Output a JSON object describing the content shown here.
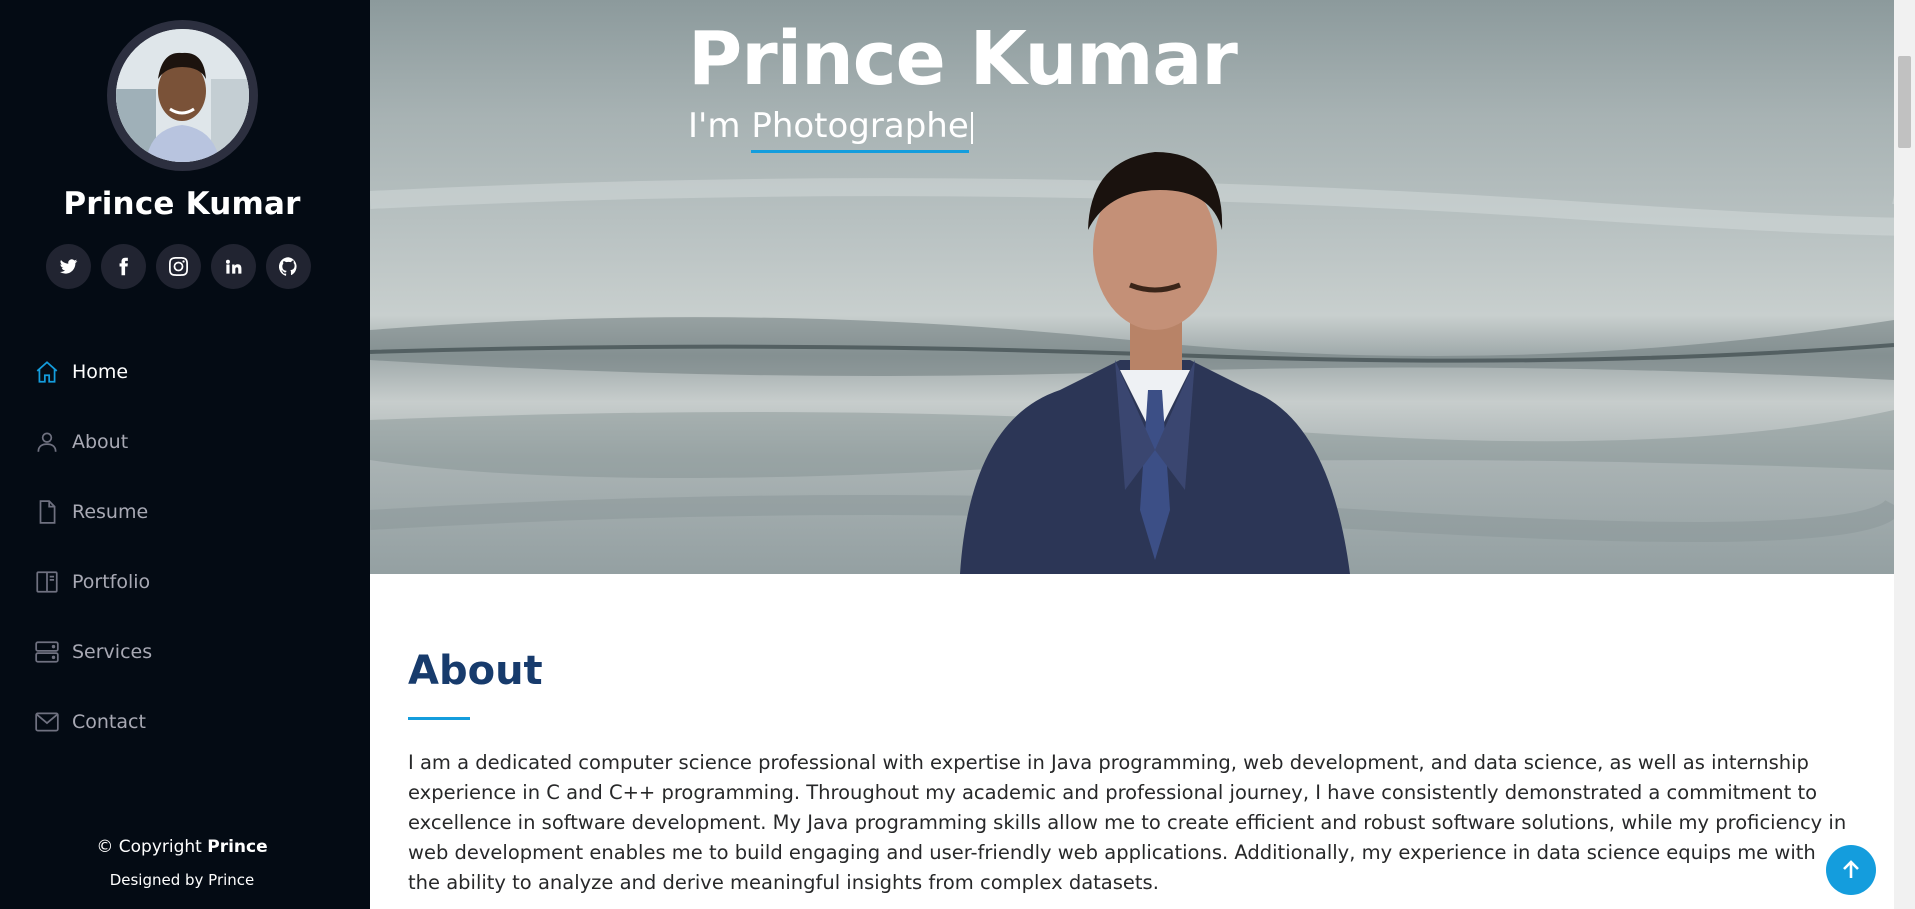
{
  "sidebar": {
    "name": "Prince Kumar",
    "socials": [
      {
        "icon": "twitter-icon"
      },
      {
        "icon": "facebook-icon"
      },
      {
        "icon": "instagram-icon"
      },
      {
        "icon": "linkedin-icon"
      },
      {
        "icon": "github-icon"
      }
    ],
    "nav": [
      {
        "label": "Home",
        "icon": "home-icon",
        "active": true
      },
      {
        "label": "About",
        "icon": "person-icon",
        "active": false
      },
      {
        "label": "Resume",
        "icon": "file-icon",
        "active": false
      },
      {
        "label": "Portfolio",
        "icon": "book-half-icon",
        "active": false
      },
      {
        "label": "Services",
        "icon": "server-icon",
        "active": false
      },
      {
        "label": "Contact",
        "icon": "envelope-icon",
        "active": false
      }
    ],
    "copyright_prefix": "© Copyright",
    "copyright_name": "Prince",
    "credits": "Designed by Prince"
  },
  "hero": {
    "title": "Prince Kumar",
    "sub_prefix": "I'm",
    "typed": "Photographe"
  },
  "about": {
    "title": "About",
    "text": "I am a dedicated computer science professional with expertise in Java programming, web development, and data science, as well as internship experience in C and C++ programming. Throughout my academic and professional journey, I have consistently demonstrated a commitment to excellence in software development. My Java programming skills allow me to create efficient and robust software solutions, while my proficiency in web development enables me to build engaging and user-friendly web applications. Additionally, my experience in data science equips me with the ability to analyze and derive meaningful insights from complex datasets."
  },
  "colors": {
    "accent": "#149ddd",
    "sidebar_bg": "#040b14",
    "heading": "#173b6c"
  }
}
